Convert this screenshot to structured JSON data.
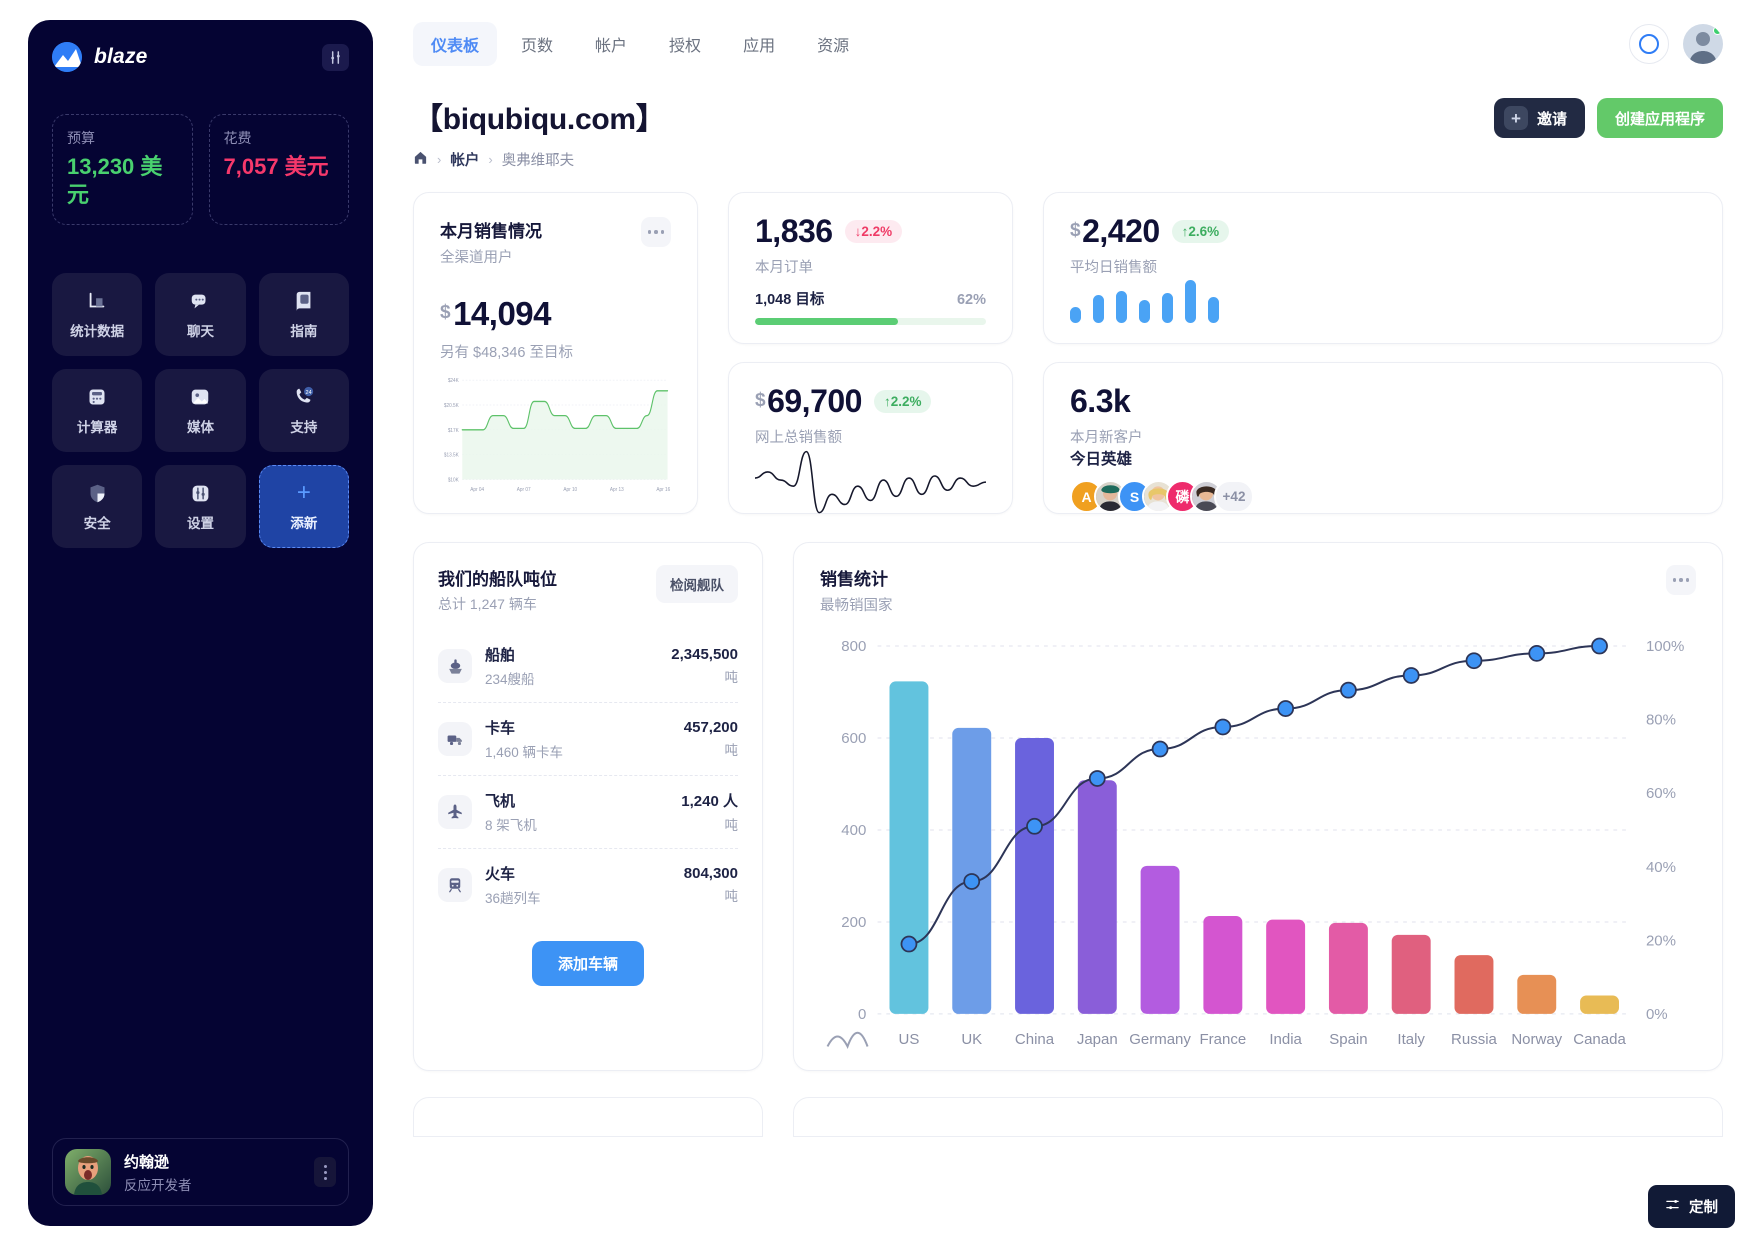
{
  "sidebar": {
    "brand": "blaze",
    "settings_icon": "sliders-icon",
    "budget": [
      {
        "label": "预算",
        "value": "13,230 美元",
        "color": "#49d16f"
      },
      {
        "label": "花费",
        "value": "7,057 美元",
        "color": "#f6386b"
      }
    ],
    "nav": [
      {
        "label": "统计数据",
        "icon": "bar-chart-icon"
      },
      {
        "label": "聊天",
        "icon": "chat-icon"
      },
      {
        "label": "指南",
        "icon": "book-icon"
      },
      {
        "label": "计算器",
        "icon": "calculator-icon"
      },
      {
        "label": "媒体",
        "icon": "image-icon"
      },
      {
        "label": "支持",
        "icon": "support-24-icon"
      },
      {
        "label": "安全",
        "icon": "shield-icon"
      },
      {
        "label": "设置",
        "icon": "sliders-icon"
      },
      {
        "label": "添新",
        "icon": "plus-icon"
      }
    ],
    "profile": {
      "name": "约翰逊",
      "role": "反应开发者",
      "avatar": "user-avatar"
    }
  },
  "topbar": {
    "tabs": [
      {
        "label": "仪表板",
        "active": true
      },
      {
        "label": "页数",
        "active": false
      },
      {
        "label": "帐户",
        "active": false
      },
      {
        "label": "授权",
        "active": false
      },
      {
        "label": "应用",
        "active": false
      },
      {
        "label": "资源",
        "active": false
      }
    ],
    "search_icon": "circle-icon",
    "account_avatar": "avatar-icon"
  },
  "header": {
    "title": "【biqubiqu.com】",
    "breadcrumb": [
      "home-icon",
      "帐户",
      "奥弗维耶夫"
    ],
    "invite_button": "邀请",
    "create_button": "创建应用程序"
  },
  "cards": {
    "orders": {
      "value": "1,836",
      "delta": "2.2%",
      "delta_dir": "down",
      "label": "本月订单",
      "goal_label": "1,048 目标",
      "goal_pct": "62%",
      "goal_fill": 62
    },
    "avg_sales": {
      "currency": "$",
      "value": "2,420",
      "delta": "2.6%",
      "delta_dir": "up",
      "label": "平均日销售额"
    },
    "total_online": {
      "currency": "$",
      "value": "69,700",
      "delta": "2.2%",
      "delta_dir": "up",
      "label": "网上总销售额"
    },
    "new_customers": {
      "value": "6.3k",
      "label": "本月新客户",
      "heroes_title": "今日英雄",
      "avatars": [
        "A",
        "",
        "S",
        "",
        "磷",
        ""
      ],
      "more": "+42"
    },
    "monthly_sales": {
      "title": "本月销售情况",
      "subtitle": "全渠道用户",
      "currency": "$",
      "value": "14,094",
      "goal_note": "另有 $48,346 至目标",
      "menu_icon": "more-icon"
    }
  },
  "fleet": {
    "title": "我们的船队吨位",
    "subtitle": "总计 1,247 辆车",
    "review_button": "检阅舰队",
    "add_button": "添加车辆",
    "rows": [
      {
        "name": "船舶",
        "meta": "234艘船",
        "value": "2,345,500",
        "unit": "吨",
        "icon": "ship-icon"
      },
      {
        "name": "卡车",
        "meta": "1,460 辆卡车",
        "value": "457,200",
        "unit": "吨",
        "icon": "truck-icon"
      },
      {
        "name": "飞机",
        "meta": "8 架飞机",
        "value": "1,240 人",
        "unit": "吨",
        "icon": "plane-icon"
      },
      {
        "name": "火车",
        "meta": "36趟列车",
        "value": "804,300",
        "unit": "吨",
        "icon": "train-icon"
      }
    ]
  },
  "sales_stats": {
    "title": "销售统计",
    "subtitle": "最畅销国家",
    "menu_icon": "more-icon"
  },
  "customize_button": {
    "label": "定制",
    "icon": "sliders-icon"
  },
  "chart_data": [
    {
      "type": "bar",
      "name": "avg-daily-sales-minibars",
      "categories": [
        "1",
        "2",
        "3",
        "4",
        "5",
        "6",
        "7"
      ],
      "values": [
        28,
        48,
        56,
        40,
        52,
        74,
        46
      ],
      "title": "平均日销售额",
      "xlabel": "",
      "ylabel": "",
      "ylim": [
        0,
        80
      ],
      "color": "#4aa3f5",
      "grid": false,
      "legend": "none"
    },
    {
      "type": "line",
      "name": "online-sales-sparkline",
      "x": [
        0,
        1,
        2,
        3,
        4,
        5,
        6,
        7,
        8,
        9,
        10,
        11,
        12,
        13,
        14,
        15,
        16,
        17,
        18
      ],
      "values": [
        52,
        58,
        50,
        44,
        78,
        18,
        36,
        26,
        44,
        30,
        50,
        34,
        52,
        36,
        54,
        40,
        52,
        44,
        48
      ],
      "title": "网上总销售额",
      "xlabel": "",
      "ylabel": "",
      "color": "#16182c",
      "grid": false,
      "legend": "none"
    },
    {
      "type": "area",
      "name": "monthly-sales-line",
      "title": "本月销售情况",
      "subtitle": "全渠道用户",
      "x": [
        "Apr 04",
        "Apr 07",
        "Apr 10",
        "Apr 13",
        "Apr 16"
      ],
      "xtick_labels": [
        "Apr 04",
        "Apr 07",
        "Apr 10",
        "Apr 13",
        "Apr 16"
      ],
      "ytick_labels": [
        "$24K",
        "$20.5K",
        "$17K",
        "$13.5K",
        "$10K"
      ],
      "ylim": [
        10000,
        24000
      ],
      "values": [
        17000,
        17000,
        17000,
        19000,
        19000,
        17200,
        17200,
        21000,
        21000,
        19000,
        19000,
        17200,
        17200,
        19000,
        19000,
        17200,
        17200,
        17200,
        19000,
        22500,
        22500
      ],
      "color": "#5ec26a",
      "fill": "#eaf7ec",
      "grid": true,
      "legend": "none"
    },
    {
      "type": "bar",
      "name": "sales-by-country-pareto",
      "title": "销售统计",
      "subtitle": "最畅销国家",
      "categories": [
        "US",
        "UK",
        "China",
        "Japan",
        "Germany",
        "France",
        "India",
        "Spain",
        "Italy",
        "Russia",
        "Norway",
        "Canada"
      ],
      "values": [
        723,
        622,
        600,
        508,
        322,
        213,
        205,
        198,
        172,
        128,
        85,
        40
      ],
      "ylabel": "",
      "xlabel": "",
      "ylim": [
        0,
        800
      ],
      "ytick_labels": [
        "0",
        "200",
        "400",
        "600",
        "800"
      ],
      "bar_colors": [
        "#62c3de",
        "#6d9de8",
        "#6a63dd",
        "#8a5ed9",
        "#b champagne",
        "#d455d0",
        "#e155c0",
        "#e35ba6",
        "#e0607f",
        "#e06a5f",
        "#e79055",
        "#e8bb55"
      ],
      "series": [
        {
          "name": "cumulative-percent",
          "type": "line",
          "values": [
            19,
            36,
            51,
            64,
            72,
            78,
            83,
            88,
            92,
            96,
            98,
            100
          ],
          "axis": "right",
          "ytick_labels": [
            "0%",
            "20%",
            "40%",
            "60%",
            "80%",
            "100%"
          ],
          "color": "#2d3557",
          "marker_color": "#3d93f5"
        }
      ],
      "grid": true,
      "legend": "none"
    }
  ]
}
